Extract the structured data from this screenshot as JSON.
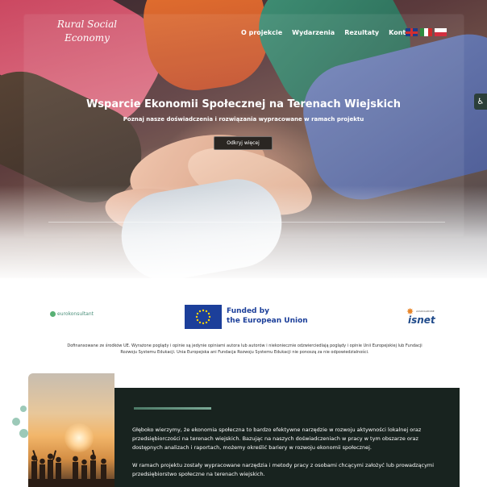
{
  "brand": {
    "logo_text": "Rural Social Economy"
  },
  "nav": {
    "items": [
      {
        "label": "O projekcie"
      },
      {
        "label": "Wydarzenia"
      },
      {
        "label": "Rezultaty"
      },
      {
        "label": "Kontakt"
      }
    ],
    "languages": [
      "uk-flag-icon",
      "it-flag-icon",
      "pl-flag-icon"
    ]
  },
  "hero": {
    "title": "Wsparcie Ekonomii Społecznej na Terenach Wiejskich",
    "subtitle": "Poznaj nasze doświadczenia i rozwiązania wypracowane w ramach projektu",
    "cta_label": "Odkryj więcej"
  },
  "partners": {
    "konsultant_logo_text": "eurokonsultant",
    "eu_text_line1": "Funded by",
    "eu_text_line2": "the European Union",
    "isnet_small_text": "ASSOCIAZIONE",
    "isnet_word": "isnet"
  },
  "disclaimer": "Dofinansowane ze środków UE. Wyrażone poglądy i opinie są jedynie opiniami autora lub autorów i niekoniecznie odzwierciedlają poglądy i opinie Unii Europejskiej lub Fundacji Rozwoju Systemu Edukacji. Unia Europejska ani Fundacja Rozwoju Systemu Edukacji nie ponoszą za nie odpowiedzialności.",
  "about": {
    "paragraph1": "Głęboko wierzymy, że ekonomia społeczna to bardzo efektywne narzędzie w rozwoju aktywności lokalnej oraz przedsiębiorczości na terenach wiejskich. Bazując na naszych doświadczeniach w pracy w tym obszarze oraz dostępnych analizach i raportach, możemy określić bariery w rozwoju ekonomii społecznej.",
    "paragraph2": "W ramach projektu zostały wypracowane narzędzia i metody pracy z osobami chcącymi założyć lub prowadzącymi przedsiębiorstwo społeczne na terenach wiejskich."
  },
  "accessibility": {
    "icon": "accessibility-icon",
    "glyph": "♿"
  },
  "colors": {
    "dark_panel": "#18231f",
    "accent_green": "#4d7a67",
    "eu_blue": "#1c3f9a"
  }
}
